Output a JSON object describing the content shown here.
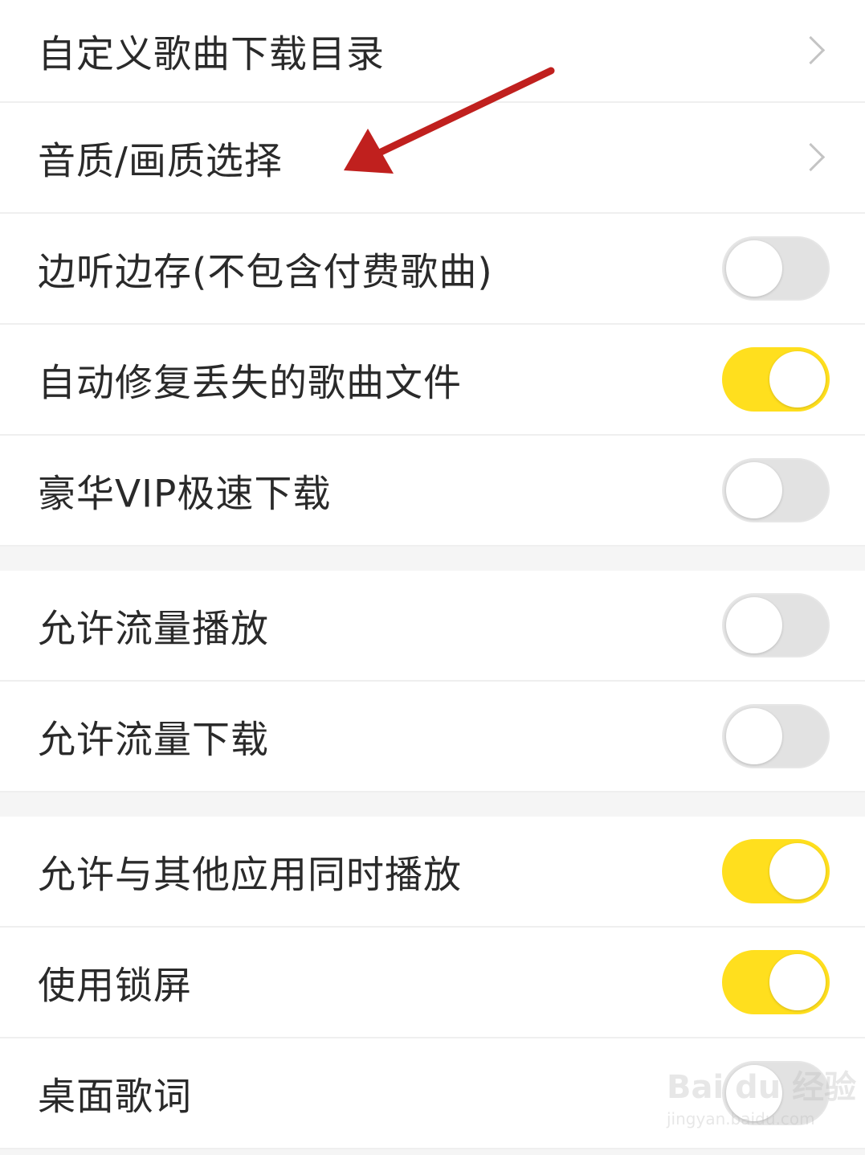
{
  "settings": {
    "items": [
      {
        "label": "自定义歌曲下载目录",
        "control": "chevron"
      },
      {
        "label": "音质/画质选择",
        "control": "chevron"
      },
      {
        "label": "边听边存(不包含付费歌曲)",
        "control": "toggle",
        "on": false
      },
      {
        "label": "自动修复丢失的歌曲文件",
        "control": "toggle",
        "on": true
      },
      {
        "label": "豪华VIP极速下载",
        "control": "toggle",
        "on": false
      },
      {
        "label": "允许流量播放",
        "control": "toggle",
        "on": false
      },
      {
        "label": "允许流量下载",
        "control": "toggle",
        "on": false
      },
      {
        "label": "允许与其他应用同时播放",
        "control": "toggle",
        "on": true
      },
      {
        "label": "使用锁屏",
        "control": "toggle",
        "on": true
      },
      {
        "label": "桌面歌词",
        "control": "toggle",
        "on": false
      }
    ]
  },
  "colors": {
    "toggle_on": "#ffdf1e",
    "toggle_off": "#e2e2e2",
    "annotation_arrow": "#c0201e"
  },
  "annotation": {
    "icon": "red-arrow-icon",
    "points_to": "音质/画质选择"
  },
  "watermark": {
    "main": "Bai du 经验",
    "sub": "jingyan.baidu.com"
  }
}
